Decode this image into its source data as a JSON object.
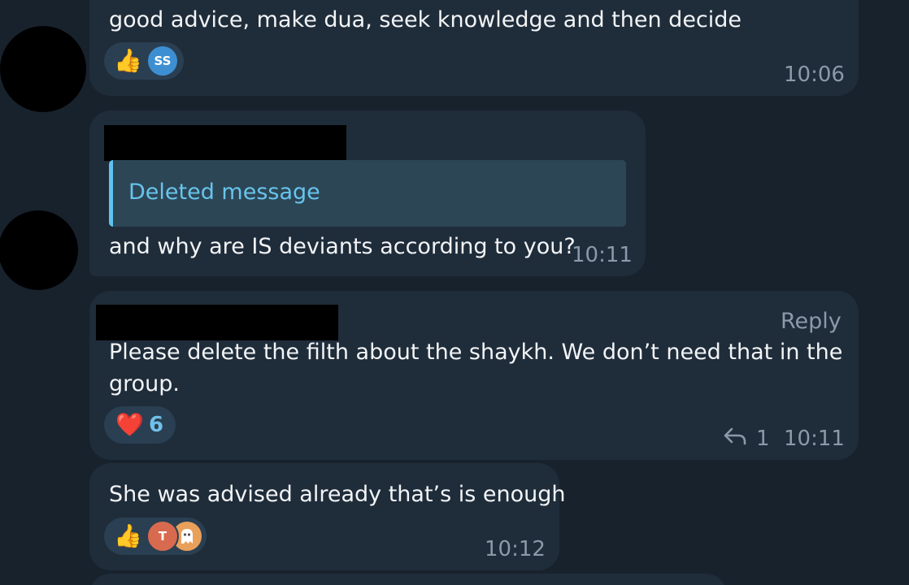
{
  "messages": [
    {
      "text_lines": [
        "good advice, make dua, seek knowledge and then decide"
      ],
      "time": "10:06",
      "reaction": {
        "emoji": "👍",
        "avatars": [
          {
            "initials": "SS",
            "color": "#3d8fd1"
          }
        ]
      }
    },
    {
      "quoted": "Deleted message",
      "text_lines": [
        "and why are IS deviants according to you?"
      ],
      "time": "10:11"
    },
    {
      "reply_label": "Reply",
      "text_lines": [
        "Please delete the filth about the shaykh. We don’t need that in the",
        "group."
      ],
      "time": "10:11",
      "reaction": {
        "emoji": "❤️",
        "count": "6"
      },
      "replies": {
        "icon": "reply-arrow-icon",
        "count": "1"
      }
    },
    {
      "text_lines": [
        "She was advised already that’s is enough"
      ],
      "time": "10:12",
      "reaction": {
        "emoji": "👍",
        "avatars": [
          {
            "initials": "T",
            "color": "#d86a4f"
          },
          {
            "initials": "",
            "icon": "ghost-icon",
            "color": "#e9a05a"
          }
        ]
      }
    }
  ],
  "colors": {
    "background": "#18222d",
    "bubble": "#1f2c3a",
    "quote_accent": "#5fc3ee",
    "time": "#8a9aab"
  }
}
